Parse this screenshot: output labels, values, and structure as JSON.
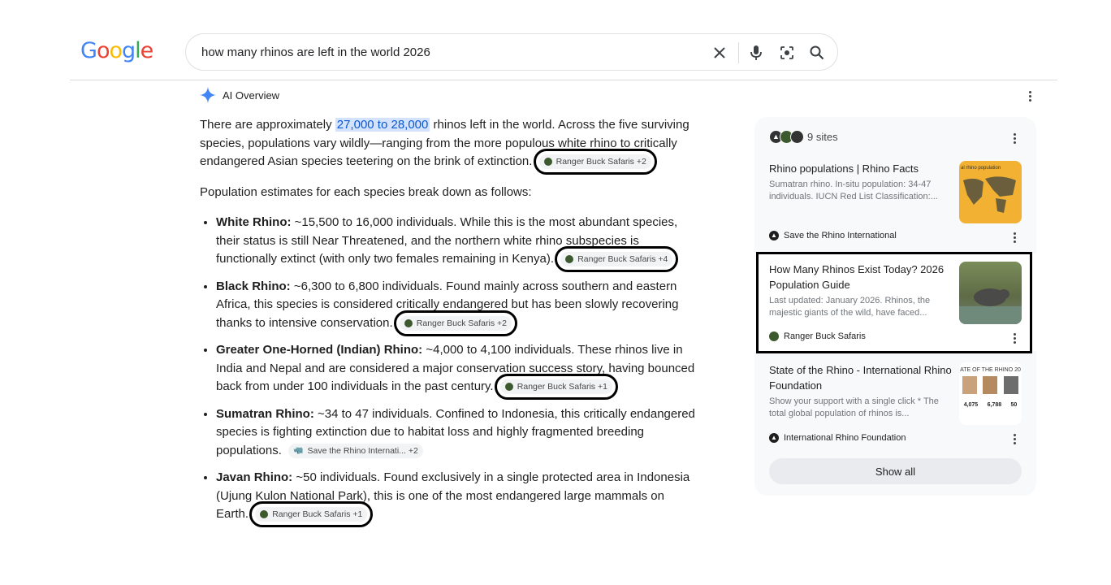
{
  "logo": {
    "letters": [
      "G",
      "o",
      "o",
      "g",
      "l",
      "e"
    ],
    "colors": [
      "#4285f4",
      "#ea4335",
      "#fbbc05",
      "#4285f4",
      "#34a853",
      "#ea4335"
    ]
  },
  "search": {
    "query": "how many rhinos are left in the world 2026"
  },
  "icons": {
    "clear": "close-icon",
    "voice": "mic-icon",
    "lens": "lens-icon",
    "search": "search-icon"
  },
  "ai_overview": {
    "title": "AI Overview",
    "intro_before": "There are approximately ",
    "intro_highlight": "27,000 to 28,000",
    "intro_after": " rhinos left in the world. Across the five surviving species, populations vary wildly—ranging from the more populous white rhino to critically endangered Asian species teetering on the brink of extinction.",
    "intro_chip": "Ranger Buck Safaris +2",
    "breakdown_intro": "Population estimates for each species break down as follows:",
    "species": [
      {
        "name": "White Rhino:",
        "text": " ~15,500 to 16,000 individuals. While this is the most abundant species, their status is still Near Threatened, and the northern white rhino subspecies is functionally extinct (with only two females remaining in Kenya).",
        "chip": "Ranger Buck Safaris +4"
      },
      {
        "name": "Black Rhino:",
        "text": " ~6,300 to 6,800 individuals. Found mainly across southern and eastern Africa, this species is considered critically endangered but has been slowly recovering thanks to intensive conservation.",
        "chip": "Ranger Buck Safaris +2"
      },
      {
        "name": "Greater One-Horned (Indian) Rhino:",
        "text": " ~4,000 to 4,100 individuals. These rhinos live in India and Nepal and are considered a major conservation success story, having bounced back from under 100 individuals in the past century.",
        "chip": "Ranger Buck Safaris +1"
      },
      {
        "name": "Sumatran Rhino:",
        "text": " ~34 to 47 individuals. Confined to Indonesia, this critically endangered species is fighting extinction due to habitat loss and highly fragmented breeding populations.",
        "chip": "Save the Rhino Internati... +2"
      },
      {
        "name": "Javan Rhino:",
        "text": " ~50 individuals. Found exclusively in a single protected area in Indonesia (Ujung Kulon National Park), this is one of the most endangered large mammals on Earth.",
        "chip": "Ranger Buck Safaris +1"
      }
    ]
  },
  "sources": {
    "count_label": "9 sites",
    "cards": [
      {
        "title": "Rhino populations | Rhino Facts",
        "snippet": "Sumatran rhino. In-situ population: 34-47 individuals. IUCN Red List Classification:...",
        "source": "Save the Rhino International",
        "thumb_text": "al rhino population"
      },
      {
        "title": "How Many Rhinos Exist Today? 2026 Population Guide",
        "snippet": "Last updated: January 2026. Rhinos, the majestic giants of the wild, have faced...",
        "source": "Ranger Buck Safaris"
      },
      {
        "title": "State of the Rhino - International Rhino Foundation",
        "snippet": "Show your support with a single click * The total global population of rhinos is...",
        "source": "International Rhino Foundation",
        "thumb_text": "ATE OF THE RHINO 20",
        "thumb_numbers": [
          "4,075",
          "6,788",
          "50"
        ]
      }
    ],
    "show_all": "Show all"
  }
}
